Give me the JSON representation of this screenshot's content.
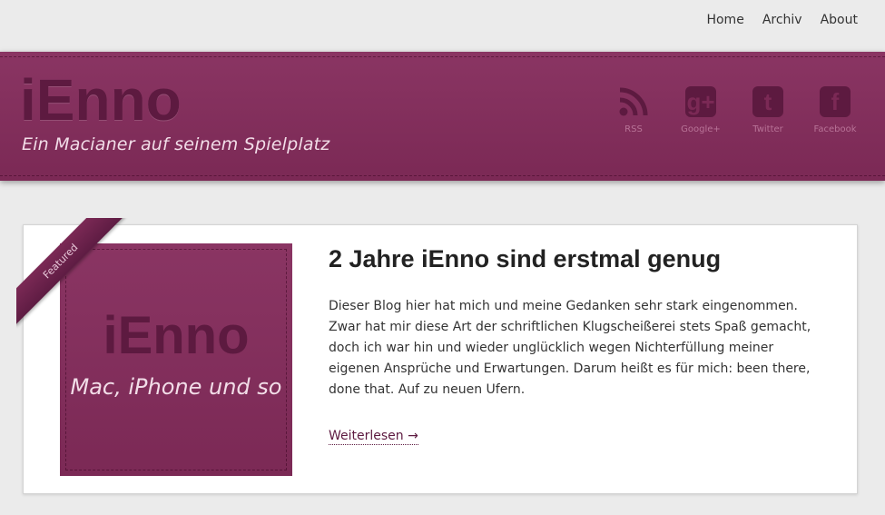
{
  "nav": {
    "items": [
      {
        "label": "Home"
      },
      {
        "label": "Archiv"
      },
      {
        "label": "About"
      }
    ]
  },
  "header": {
    "title": "iEnno",
    "tagline": "Ein Macianer auf seinem Spielplatz",
    "brand_color": "#7b2955",
    "social": [
      {
        "label": "RSS",
        "icon": "rss-icon"
      },
      {
        "label": "Google+",
        "icon": "google-plus-icon"
      },
      {
        "label": "Twitter",
        "icon": "twitter-icon"
      },
      {
        "label": "Facebook",
        "icon": "facebook-icon"
      }
    ]
  },
  "post": {
    "badge": "Featured",
    "thumbnail_title": "iEnno",
    "thumbnail_subtitle": "Mac, iPhone und so",
    "title": "2 Jahre iEnno sind erstmal genug",
    "excerpt": "Dieser Blog hier hat mich und meine Gedanken sehr stark eingenommen. Zwar hat mir diese Art der schriftlichen Klugscheißerei stets Spaß gemacht, doch ich war hin und wieder unglücklich wegen Nichterfüllung meiner eigenen Ansprüche und Erwartungen. Darum heißt es für mich: been there, done that. Auf zu neuen Ufern.",
    "read_more": "Weiterlesen →"
  }
}
